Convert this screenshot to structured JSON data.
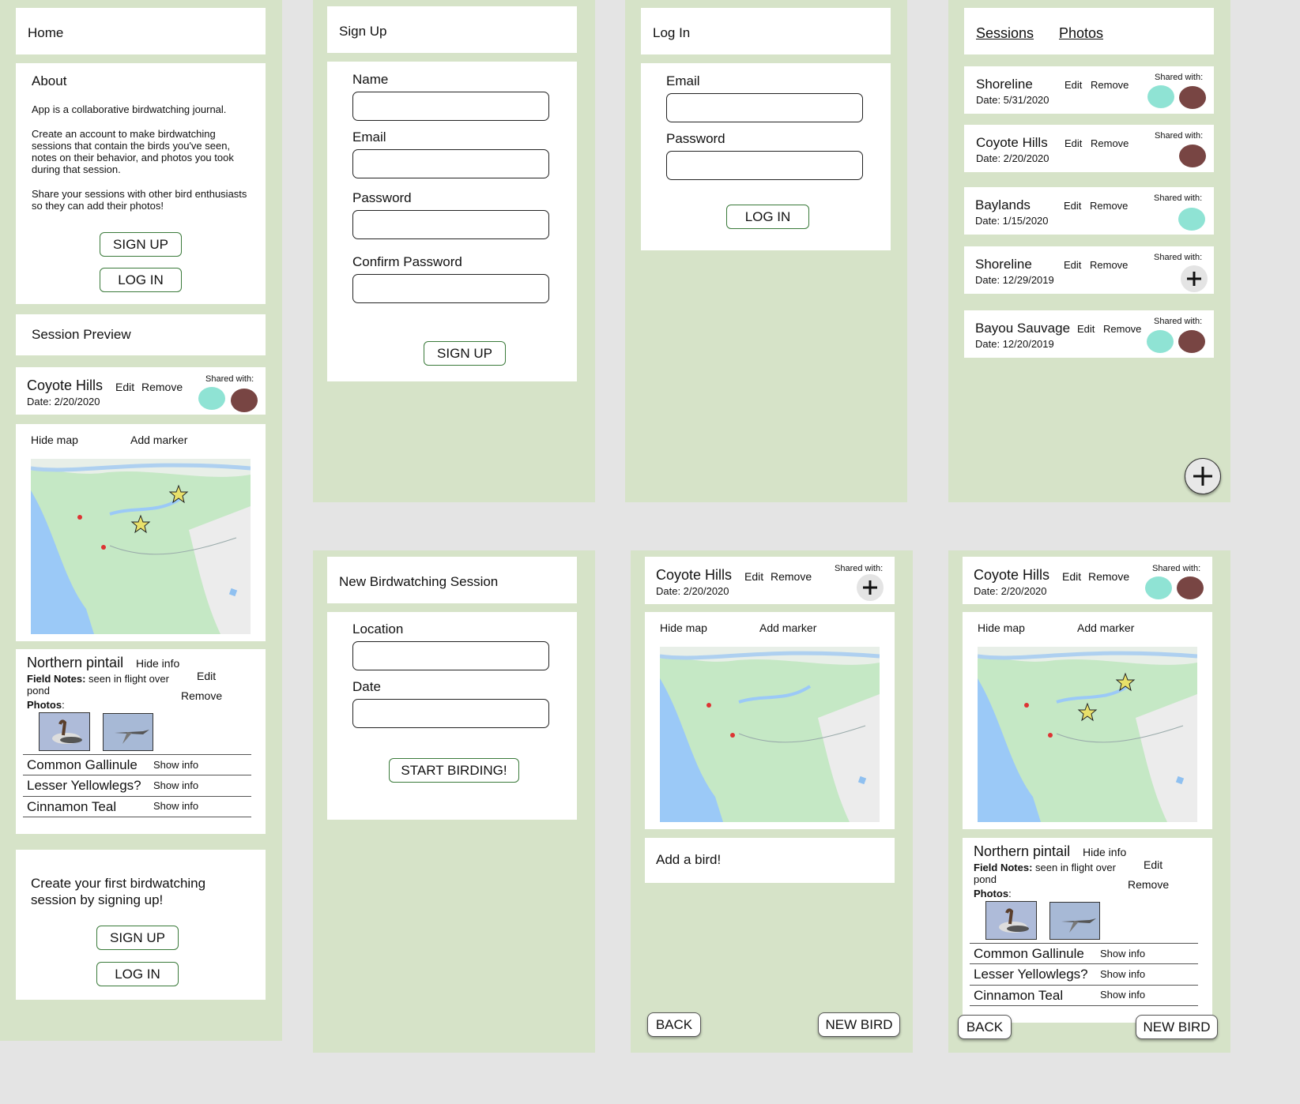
{
  "colors": {
    "panel_bg": "#d6e3c8",
    "teal": "#8fe3d4",
    "brown": "#784543",
    "button_border": "#3a7a3a"
  },
  "home": {
    "title": "Home",
    "about_title": "About",
    "about_p1": "App is a collaborative birdwatching journal.",
    "about_p2": "Create an account to make birdwatching sessions that contain the birds you've seen, notes on their behavior, and photos you took during that session.",
    "about_p3": "Share your sessions with other bird enthusiasts so they can add their photos!",
    "signup": "SIGN UP",
    "login": "LOG IN",
    "preview_title": "Session Preview",
    "cta_text": "Create your first birdwatching session by signing up!"
  },
  "session": {
    "name": "Coyote Hills",
    "date": "Date: 2/20/2020",
    "edit": "Edit",
    "remove": "Remove",
    "shared_with": "Shared with:",
    "hide_map": "Hide map",
    "add_marker": "Add marker"
  },
  "bird": {
    "name": "Northern pintail",
    "hide_info": "Hide info",
    "notes_label": "Field Notes:",
    "notes": "seen in flight over pond",
    "photos_label": "Photos",
    "photos_colon": ":",
    "edit": "Edit",
    "remove": "Remove"
  },
  "birds": [
    {
      "name": "Common Gallinule",
      "action": "Show info"
    },
    {
      "name": "Lesser Yellowlegs?",
      "action": "Show info"
    },
    {
      "name": "Cinnamon Teal",
      "action": "Show info"
    }
  ],
  "signup": {
    "title": "Sign Up",
    "name": "Name",
    "email": "Email",
    "password": "Password",
    "confirm": "Confirm Password",
    "button": "SIGN UP"
  },
  "login": {
    "title": "Log In",
    "email": "Email",
    "password": "Password",
    "button": "LOG IN"
  },
  "new_session": {
    "title": "New Birdwatching Session",
    "location": "Location",
    "date": "Date",
    "button": "START BIRDING!"
  },
  "sessions_list": {
    "tab_sessions": "Sessions",
    "tab_photos": "Photos",
    "items": [
      {
        "name": "Shoreline",
        "date": "Date: 5/31/2020",
        "edit": "Edit",
        "remove": "Remove",
        "shared": "Shared with:"
      },
      {
        "name": "Coyote Hills",
        "date": "Date: 2/20/2020",
        "edit": "Edit",
        "remove": "Remove",
        "shared": "Shared with:"
      },
      {
        "name": "Baylands",
        "date": "Date: 1/15/2020",
        "edit": "Edit",
        "remove": "Remove",
        "shared": "Shared with:"
      },
      {
        "name": "Shoreline",
        "date": "Date: 12/29/2019",
        "edit": "Edit",
        "remove": "Remove",
        "shared": "Shared with:"
      },
      {
        "name": "Bayou Sauvage",
        "date": "Date: 12/20/2019",
        "edit": "Edit",
        "remove": "Remove",
        "shared": "Shared with:"
      }
    ]
  },
  "detail": {
    "add_bird": "Add a bird!",
    "back": "BACK",
    "new_bird": "NEW BIRD"
  }
}
